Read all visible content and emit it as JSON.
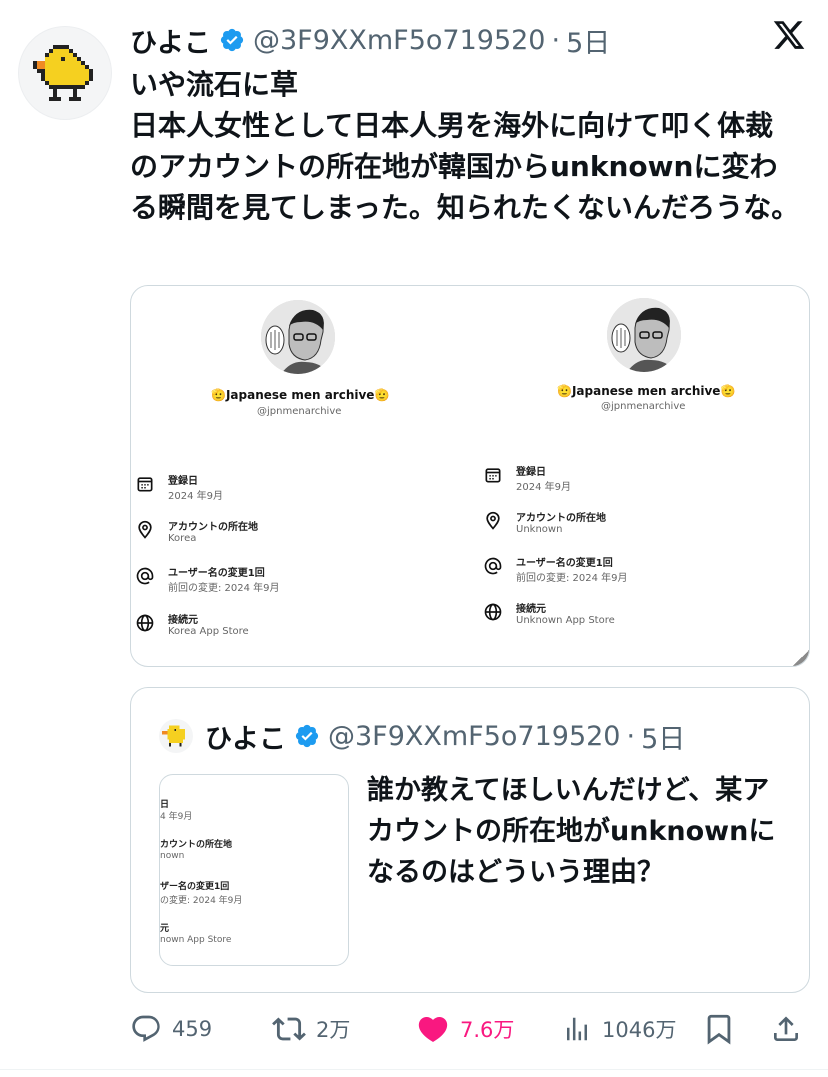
{
  "tweet": {
    "author_name": "ひよこ",
    "handle": "@3F9XXmF5o719520",
    "separator": "·",
    "time": "5日",
    "text": "いや流石に草\n日本人女性として日本人男を海外に向けて叩く体裁のアカウントの所在地が韓国からunknownに変わる瞬間を見てしまった。知られたくないんだろうな。",
    "avatar_icon": "pixel-chick-icon",
    "brand_icon": "x-logo-icon"
  },
  "media": {
    "left": {
      "profile_name": "🫡Japanese men archive🫡",
      "profile_handle": "@jpnmenarchive",
      "rows": [
        {
          "icon": "calendar-icon",
          "label": "登録日",
          "value": "2024 年9月"
        },
        {
          "icon": "location-pin-icon",
          "label": "アカウントの所在地",
          "value": "Korea"
        },
        {
          "icon": "at-sign-icon",
          "label": "ユーザー名の変更1回",
          "value": "前回の変更: 2024 年9月"
        },
        {
          "icon": "globe-icon",
          "label": "接続元",
          "value": "Korea App Store"
        }
      ]
    },
    "right": {
      "profile_name": "🫡Japanese men archive🫡",
      "profile_handle": "@jpnmenarchive",
      "rows": [
        {
          "icon": "calendar-icon",
          "label": "登録日",
          "value": "2024 年9月"
        },
        {
          "icon": "location-pin-icon",
          "label": "アカウントの所在地",
          "value": "Unknown"
        },
        {
          "icon": "at-sign-icon",
          "label": "ユーザー名の変更1回",
          "value": "前回の変更: 2024 年9月"
        },
        {
          "icon": "globe-icon",
          "label": "接続元",
          "value": "Unknown App Store"
        }
      ]
    }
  },
  "quote": {
    "author_name": "ひよこ",
    "handle": "@3F9XXmF5o719520",
    "separator": "·",
    "time": "5日",
    "text": "誰か教えてほしいんだけど、某アカウントの所在地がunknownになるのはどういう理由？",
    "thumb_lines": [
      "日",
      "4 年9月",
      "カウントの所在地",
      "nown",
      "ザー名の変更1回",
      "の変更: 2024 年9月",
      "元",
      "nown App Store"
    ]
  },
  "actions": {
    "reply_count": "459",
    "retweet_count": "2万",
    "like_count": "7.6万",
    "views_count": "1046万"
  },
  "colors": {
    "text": "#0f1419",
    "secondary": "#536471",
    "verified": "#1d9bf0",
    "like": "#f91880",
    "border": "#cfd9de"
  }
}
